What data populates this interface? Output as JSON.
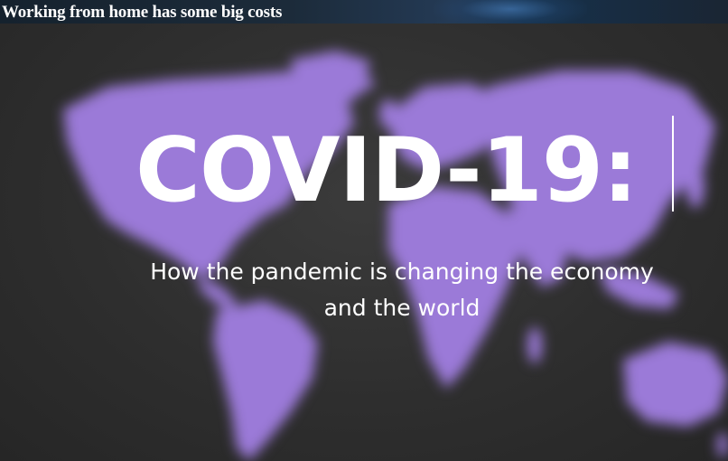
{
  "article": {
    "headline": "Working from home has some big costs"
  },
  "hero": {
    "title": "COVID-19:",
    "subtitle_line1": "How the pandemic is changing the economy",
    "subtitle_line2": "and the world"
  },
  "colors": {
    "map_fill": "#9b7ad8",
    "background": "#2b2b2b",
    "text": "#ffffff"
  },
  "icons": {
    "background_map": "world-map-icon"
  }
}
